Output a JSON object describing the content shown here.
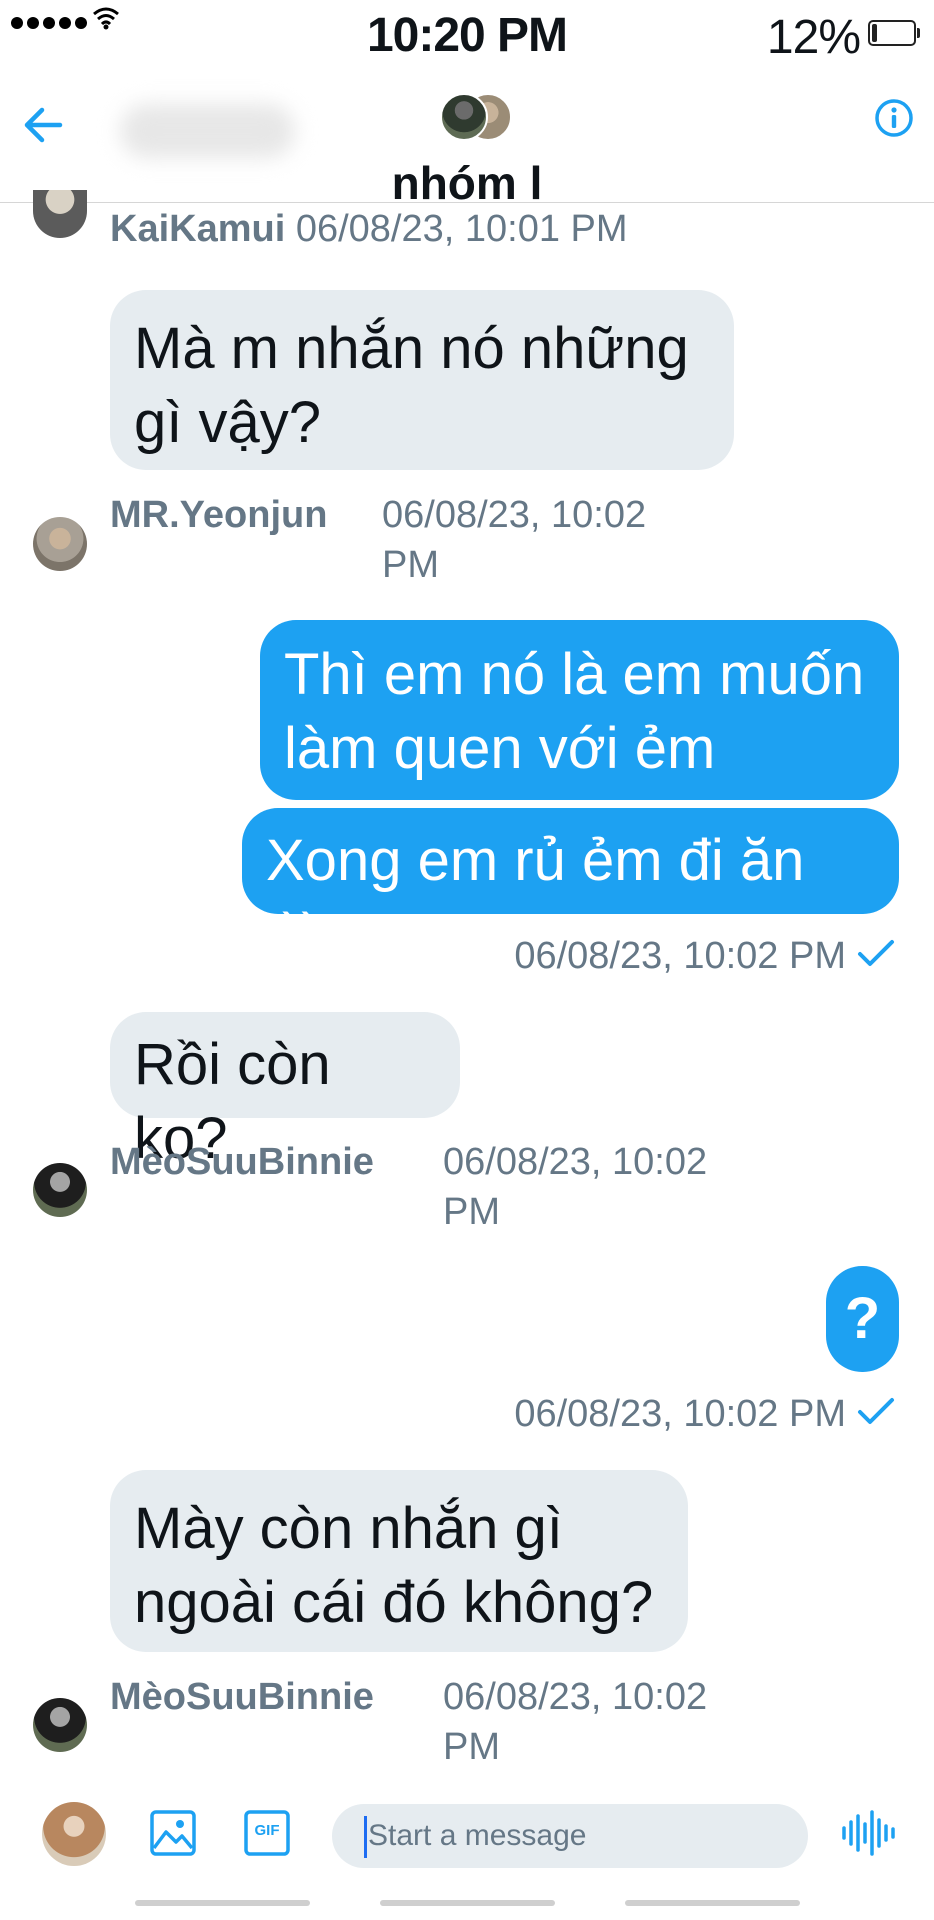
{
  "status_bar": {
    "time": "10:20 PM",
    "battery": "12%"
  },
  "header": {
    "title": "nhóm l",
    "back_icon": "arrow-left-icon",
    "info_icon": "info-icon"
  },
  "messages": [
    {
      "type": "meta",
      "username": "KaiKamui",
      "timestamp": "06/08/23, 10:01 PM"
    },
    {
      "type": "incoming",
      "text_lines": [
        "Mà m nhắn nó những",
        "gì vậy?"
      ]
    },
    {
      "type": "meta",
      "username": "MR.Yeonjun",
      "timestamp_lines": [
        "06/08/23, 10:02",
        "PM"
      ]
    },
    {
      "type": "outgoing",
      "text_lines": [
        "Thì em nó là em muốn",
        "làm quen với ẻm"
      ]
    },
    {
      "type": "outgoing",
      "text": "Xong em rủ ẻm đi ăn :))"
    },
    {
      "type": "sent_meta",
      "timestamp": "06/08/23, 10:02 PM"
    },
    {
      "type": "incoming",
      "text": "Rồi còn ko?"
    },
    {
      "type": "meta",
      "username": "MèoSuuBinnie",
      "timestamp_lines": [
        "06/08/23, 10:02",
        "PM"
      ]
    },
    {
      "type": "outgoing",
      "text": "?"
    },
    {
      "type": "sent_meta",
      "timestamp": "06/08/23, 10:02 PM"
    },
    {
      "type": "incoming",
      "text_lines": [
        "Mày còn nhắn gì",
        "ngoài cái đó không?"
      ]
    },
    {
      "type": "meta",
      "username": "MèoSuuBinnie",
      "timestamp_lines": [
        "06/08/23, 10:02",
        "PM"
      ]
    }
  ],
  "composer": {
    "placeholder": "Start a message",
    "image_icon": "image-icon",
    "gif_label": "GIF",
    "voice_icon": "voice-waveform-icon"
  },
  "colors": {
    "accent": "#1da1f2",
    "incoming_bubble": "#e6ecf0",
    "meta_text": "#657786"
  }
}
